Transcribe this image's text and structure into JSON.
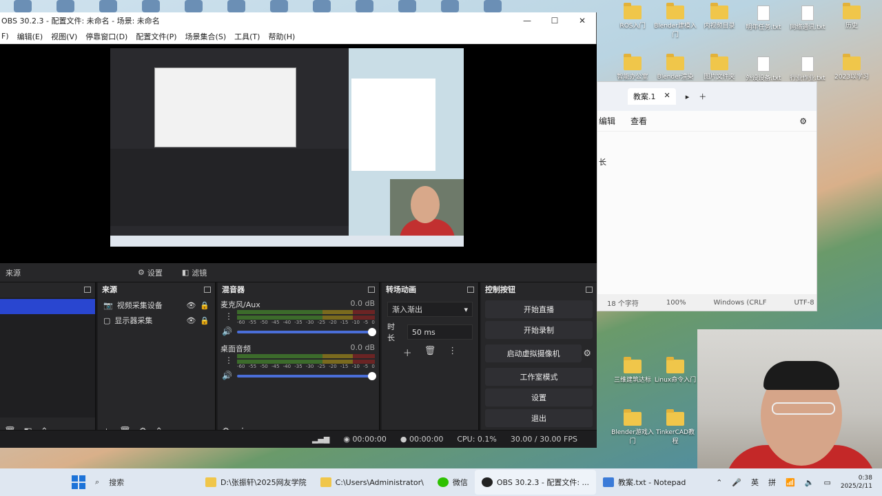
{
  "obs": {
    "title": "OBS 30.2.3 - 配置文件: 未命名 - 场景: 未命名",
    "menu": [
      "F)",
      "编辑(E)",
      "视图(V)",
      "停靠窗口(D)",
      "配置文件(P)",
      "场景集合(S)",
      "工具(T)",
      "帮助(H)"
    ],
    "context_label": "来源",
    "context_settings": "设置",
    "context_filters": "滤镜",
    "docks": {
      "sources_title": "来源",
      "mixer_title": "混音器",
      "transitions_title": "转场动画",
      "controls_title": "控制按钮"
    },
    "sources": [
      {
        "name": "视频采集设备"
      },
      {
        "name": "显示器采集"
      }
    ],
    "mixer": [
      {
        "name": "麦克风/Aux",
        "db": "0.0 dB"
      },
      {
        "name": "桌面音频",
        "db": "0.0 dB"
      }
    ],
    "meter_scale": [
      "-60",
      "-55",
      "-50",
      "-45",
      "-40",
      "-35",
      "-30",
      "-25",
      "-20",
      "-15",
      "-10",
      "-5",
      "0"
    ],
    "transition": {
      "selected": "渐入渐出",
      "duration_label": "时长",
      "duration_value": "50 ms"
    },
    "controls": {
      "start_stream": "开始直播",
      "start_record": "开始录制",
      "virtual_cam": "启动虚拟摄像机",
      "studio_mode": "工作室模式",
      "settings": "设置",
      "exit": "退出"
    },
    "status": {
      "stream_time": "00:00:00",
      "record_time": "00:00:00",
      "cpu": "CPU: 0.1%",
      "fps": "30.00 / 30.00 FPS"
    }
  },
  "notepad": {
    "tab": "教案.1",
    "menu": [
      "编辑",
      "查看"
    ],
    "side_char": "长",
    "status": {
      "chars": "18 个字符",
      "zoom": "100%",
      "eol": "Windows (CRLF",
      "enc": "UTF-8"
    }
  },
  "desktop_icons": [
    {
      "label": "ROS入门",
      "type": "folder"
    },
    {
      "label": "Blender建模入门",
      "type": "folder"
    },
    {
      "label": "内视频目录",
      "type": "folder"
    },
    {
      "label": "明年任务.txt",
      "type": "doc"
    },
    {
      "label": "网络通讯.txt",
      "type": "doc"
    },
    {
      "label": "历史",
      "type": "folder"
    },
    {
      "label": "智能办公室",
      "type": "folder"
    },
    {
      "label": "Blender渲染",
      "type": "folder"
    },
    {
      "label": "图片文件夹",
      "type": "folder"
    },
    {
      "label": "外设设备.txt",
      "type": "doc"
    },
    {
      "label": "行业作业.txt",
      "type": "doc"
    },
    {
      "label": "2023以学习",
      "type": "folder"
    },
    {
      "label": "三维建筑达标",
      "type": "folder"
    },
    {
      "label": "Linux命令入门",
      "type": "folder"
    },
    {
      "label": "Blender游戏入门",
      "type": "folder"
    },
    {
      "label": "TinkerCAD教程",
      "type": "folder"
    }
  ],
  "taskbar": {
    "search_placeholder": "搜索",
    "apps": [
      {
        "label": "D:\\张振轩\\2025网友学院"
      },
      {
        "label": "C:\\Users\\Administrator\\"
      },
      {
        "label": "微信"
      },
      {
        "label": "OBS 30.2.3 - 配置文件: ..."
      },
      {
        "label": "教案.txt - Notepad"
      }
    ],
    "ime": "英",
    "ime2": "拼",
    "time": "0:38",
    "date": "2025/2/11"
  },
  "colors": {
    "obs_bg": "#1d1d1f",
    "selected_scene": "#2946d0",
    "accent": "#4a6ed8"
  }
}
